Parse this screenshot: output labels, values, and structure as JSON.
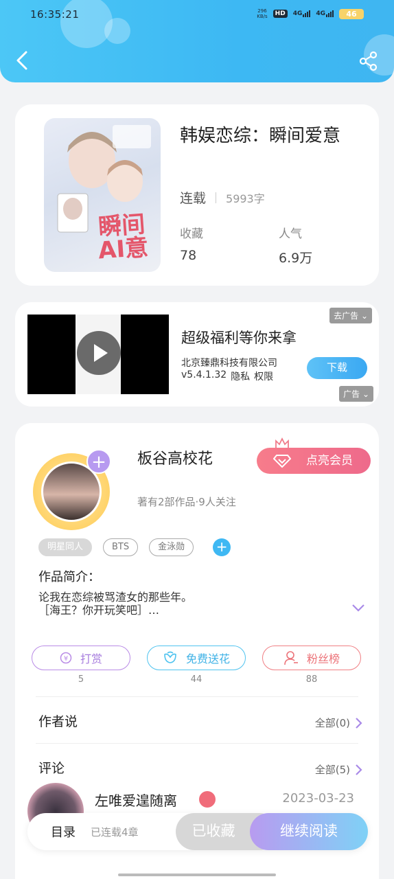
{
  "status_bar": {
    "time": "16:35:21",
    "net_speed_value": "296",
    "net_speed_unit": "KB/s",
    "hd": "HD",
    "network1": "4G",
    "network2": "4G",
    "battery": "46"
  },
  "header": {
    "back_icon": "chevron-left-icon",
    "share_icon": "share-icon"
  },
  "book": {
    "title": "韩娱恋综：瞬间爱意",
    "status": "连载",
    "word_count": "5993字",
    "stats": [
      {
        "label": "收藏",
        "value": "78"
      },
      {
        "label": "人气",
        "value": "6.9万"
      }
    ],
    "cover_title": "瞬间\nAI意"
  },
  "ad": {
    "close_tag": "去广告",
    "title": "超级福利等你来拿",
    "company": "北京臻鼎科技有限公司",
    "version": "v5.4.1.32",
    "privacy": "隐私",
    "permission": "权限",
    "download_label": "下载",
    "ad_tag": "广告"
  },
  "author": {
    "name": "板谷高校花",
    "meta": "著有2部作品·9人关注",
    "vip_label": "点亮会员",
    "tags": [
      "明星同人",
      "BTS",
      "金泳勋"
    ],
    "intro_label": "作品简介：",
    "intro_line1": "论我在恋综被骂渣女的那些年。",
    "intro_line2": "［海王？你开玩笑吧］…",
    "actions": [
      {
        "label": "打赏",
        "count": "5"
      },
      {
        "label": "免费送花",
        "count": "44"
      },
      {
        "label": "粉丝榜",
        "count": "88"
      }
    ],
    "says_label": "作者说",
    "says_more": "全部(0)",
    "comments_label": "评论",
    "comments_more": "全部(5)",
    "commenter": "左唯爱遑随离",
    "comment_date": "2023-03-23"
  },
  "bottom_bar": {
    "toc": "目录",
    "chapters": "已连载4章",
    "collected": "已收藏",
    "continue": "继续阅读"
  }
}
